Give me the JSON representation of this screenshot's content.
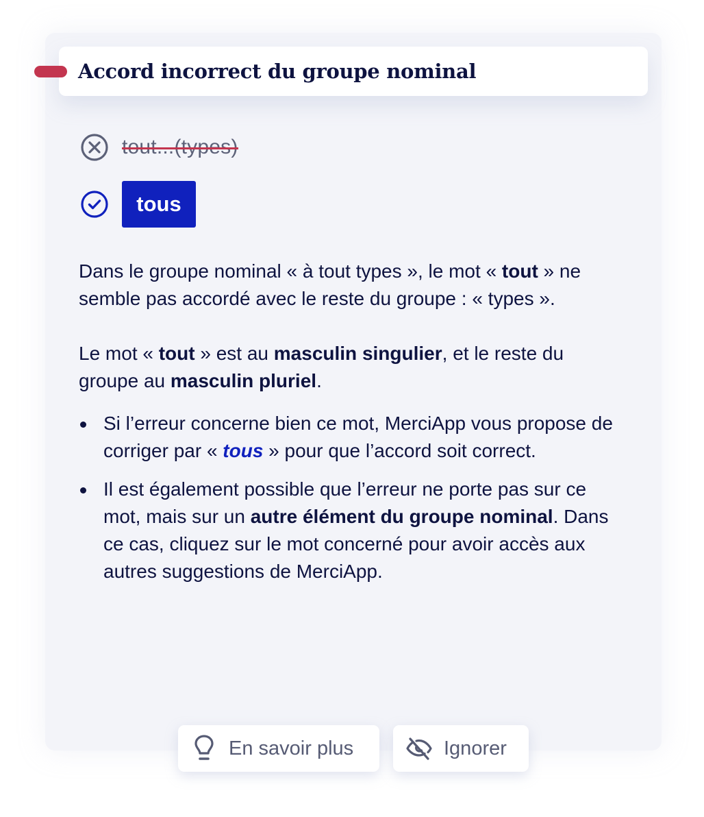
{
  "card": {
    "title": "Accord incorrect du groupe nominal",
    "severity_color": "#c3354f",
    "accent_color": "#1021bd"
  },
  "correction": {
    "original_text": "tout...(types)",
    "original_icon": "x-circle-icon",
    "suggestion_text": "tous",
    "suggestion_icon": "check-circle-icon"
  },
  "explanation": {
    "p1": {
      "a": "Dans le groupe nominal « à tout types », le mot « ",
      "b_bold": "tout",
      "c": " » ne semble pas accordé avec le reste du groupe : « types »."
    },
    "p2": {
      "a": "Le mot « ",
      "b_bold": "tout",
      "c": " » est au ",
      "d_bold": "masculin singulier",
      "e": ", et le reste du groupe au ",
      "f_bold": "masculin pluriel",
      "g": "."
    },
    "bullets": [
      {
        "a": "Si l’erreur concerne bien ce mot, MerciApp vous propose de corriger par « ",
        "b_suggestion": "tous",
        "c": " » pour que l’accord soit correct."
      },
      {
        "a": "Il est également possible que l’erreur ne porte pas sur ce mot, mais sur un ",
        "b_bold": "autre élément du groupe nominal",
        "c": ". Dans ce cas, cliquez sur le mot concerné pour avoir accès aux autres suggestions de MerciApp."
      }
    ]
  },
  "actions": {
    "learn_more": {
      "label": "En savoir plus",
      "icon": "lightbulb-icon"
    },
    "ignore": {
      "label": "Ignorer",
      "icon": "eye-off-icon"
    }
  }
}
